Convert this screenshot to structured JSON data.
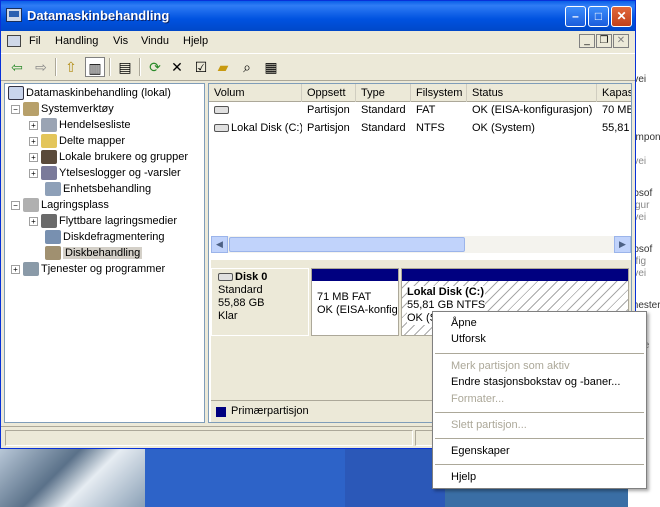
{
  "window": {
    "title": "Datamaskinbehandling"
  },
  "menubar": {
    "items": [
      "Fil",
      "Handling",
      "Vis",
      "Vindu",
      "Hjelp"
    ]
  },
  "tree": {
    "root": "Datamaskinbehandling (lokal)",
    "nodes": [
      "Systemverktøy",
      "Hendelsesliste",
      "Delte mapper",
      "Lokale brukere og grupper",
      "Ytelseslogger og -varsler",
      "Enhetsbehandling",
      "Lagringsplass",
      "Flyttbare lagringsmedier",
      "Diskdefragmentering",
      "Diskbehandling",
      "Tjenester og programmer"
    ]
  },
  "volumes": {
    "headers": [
      "Volum",
      "Oppsett",
      "Type",
      "Filsystem",
      "Status",
      "Kapasi"
    ],
    "rows": [
      {
        "volum": "",
        "oppsett": "Partisjon",
        "type": "Standard",
        "filsystem": "FAT",
        "status": "OK (EISA-konfigurasjon)",
        "kapasitet": "70 MB"
      },
      {
        "volum": "Lokal Disk (C:)",
        "oppsett": "Partisjon",
        "type": "Standard",
        "filsystem": "NTFS",
        "status": "OK (System)",
        "kapasitet": "55,81"
      }
    ]
  },
  "disk": {
    "name": "Disk 0",
    "type": "Standard",
    "size": "55,88 GB",
    "state": "Klar",
    "partitions": [
      {
        "title": "",
        "size": "71 MB FAT",
        "status": "OK (EISA-konfig"
      },
      {
        "title": "Lokal Disk  (C:)",
        "size": "55,81 GB NTFS",
        "status": "OK (S"
      }
    ]
  },
  "legend": {
    "primary": "Primærpartisjon"
  },
  "context_menu": {
    "items": [
      {
        "label": "Åpne",
        "enabled": true
      },
      {
        "label": "Utforsk",
        "enabled": true
      },
      {
        "label": "Merk partisjon som aktiv",
        "enabled": false
      },
      {
        "label": "Endre stasjonsbokstav og -baner...",
        "enabled": true
      },
      {
        "label": "Formater...",
        "enabled": false
      },
      {
        "label": "Slett partisjon...",
        "enabled": false
      },
      {
        "label": "Egenskaper",
        "enabled": true
      },
      {
        "label": "Hjelp",
        "enabled": true
      }
    ]
  },
  "desktop": {
    "fragments": [
      "1",
      "rvei",
      "ompone",
      "n",
      "rvei",
      "rosof",
      "figur",
      "rvei",
      "rosof",
      "nfig",
      "rvei",
      "mester",
      "n",
      "erve"
    ]
  },
  "colors": {
    "titlebar": "#0054e3",
    "primary_partition": "#000080",
    "tree_selection": "#d4d0c8"
  }
}
